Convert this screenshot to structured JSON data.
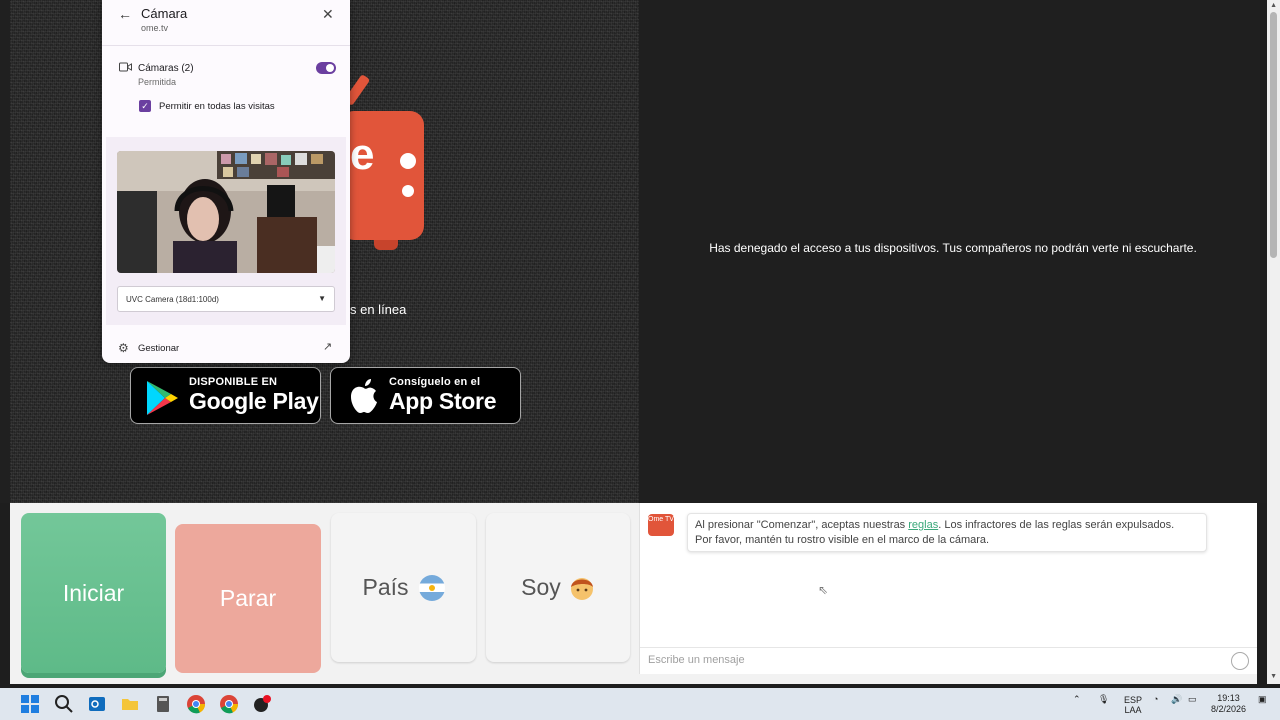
{
  "remote": {
    "denied_message": "Has denegado el acceso a tus dispositivos. Tus compañeros no podrán verte ni escucharte."
  },
  "background": {
    "online_text": "s en línea",
    "logo_letter": "e"
  },
  "stores": {
    "google_small": "DISPONIBLE EN",
    "google_big": "Google Play",
    "apple_small": "Consíguelo en el",
    "apple_big": "App Store"
  },
  "popup": {
    "title": "Cámara",
    "domain": "ome.tv",
    "cameras_label": "Cámaras (2)",
    "cameras_status": "Permitida",
    "allow_all_label": "Permitir en todas las visitas",
    "camera_select_value": "UVC Camera (18d1:100d)",
    "manage_label": "Gestionar"
  },
  "controls": {
    "start_label": "Iniciar",
    "stop_label": "Parar",
    "country_label": "País",
    "gender_label": "Soy"
  },
  "chat": {
    "avatar_text": "Ome TV",
    "message_part1": "Al presionar \"Comenzar\", aceptas nuestras ",
    "message_link": "reglas",
    "message_part2": ". Los infractores de las reglas serán expulsados.",
    "message_line2": "Por favor, mantén tu rostro visible en el marco de la cámara.",
    "input_placeholder": "Escribe un mensaje"
  },
  "taskbar": {
    "lang_top": "ESP",
    "lang_bottom": "LAA",
    "time": "19:13",
    "date": "8/2/2026"
  },
  "colors": {
    "brand": "#e1553a",
    "start": "#6cc293",
    "stop": "#eda89c",
    "toggle": "#6b3fa0"
  }
}
